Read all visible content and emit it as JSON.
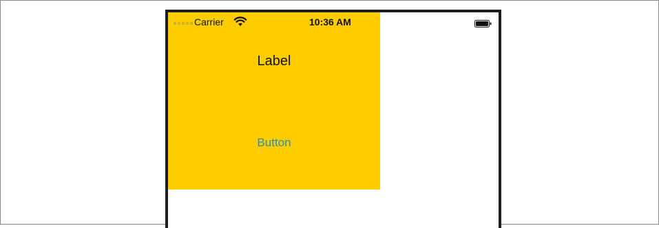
{
  "status_bar": {
    "carrier": "Carrier",
    "time": "10:36 AM",
    "icons": [
      "signal-dots-icon",
      "wifi-icon",
      "battery-icon"
    ]
  },
  "main": {
    "label_text": "Label",
    "button_label": "Button"
  },
  "colors": {
    "yellow_view": "#ffcc00",
    "button_tint": "#2f8fb0",
    "device_border": "#1e1e1e"
  }
}
